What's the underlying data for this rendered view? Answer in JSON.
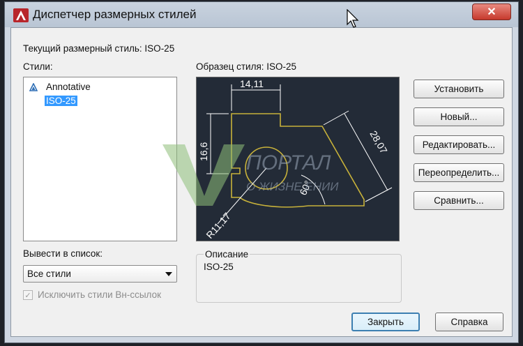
{
  "window": {
    "title": "Диспетчер размерных стилей",
    "close_glyph": "✕"
  },
  "current_style_label": "Текущий размерный стиль: ISO-25",
  "styles": {
    "label": "Стили:",
    "items": [
      {
        "name": "Annotative",
        "icon": "annotative-triangle-icon"
      },
      {
        "name": "ISO-25",
        "selected": true
      }
    ]
  },
  "preview": {
    "label": "Образец стиля: ISO-25",
    "dims": [
      "14,11",
      "16,6",
      "28,07",
      "60°",
      "R11,17"
    ]
  },
  "list_filter": {
    "label": "Вывести в список:",
    "selected": "Все стили"
  },
  "exclude_xref": {
    "label": "Исключить стили Вн-ссылок",
    "checked": true,
    "disabled": true
  },
  "description": {
    "title": "Описание",
    "text": "ISO-25"
  },
  "buttons": {
    "set_current": "Установить",
    "new": "Новый...",
    "modify": "Редактировать...",
    "override": "Переопределить...",
    "compare": "Сравнить...",
    "close": "Закрыть",
    "help": "Справка"
  },
  "watermark": {
    "line1": "ПОРТАЛ",
    "line2": "О ЖИЗНЕ ЕНИИ"
  },
  "colors": {
    "preview_bg": "#232b37",
    "geometry": "#c8b23a",
    "dimensions": "#ffffff",
    "selection": "#3399ff"
  }
}
